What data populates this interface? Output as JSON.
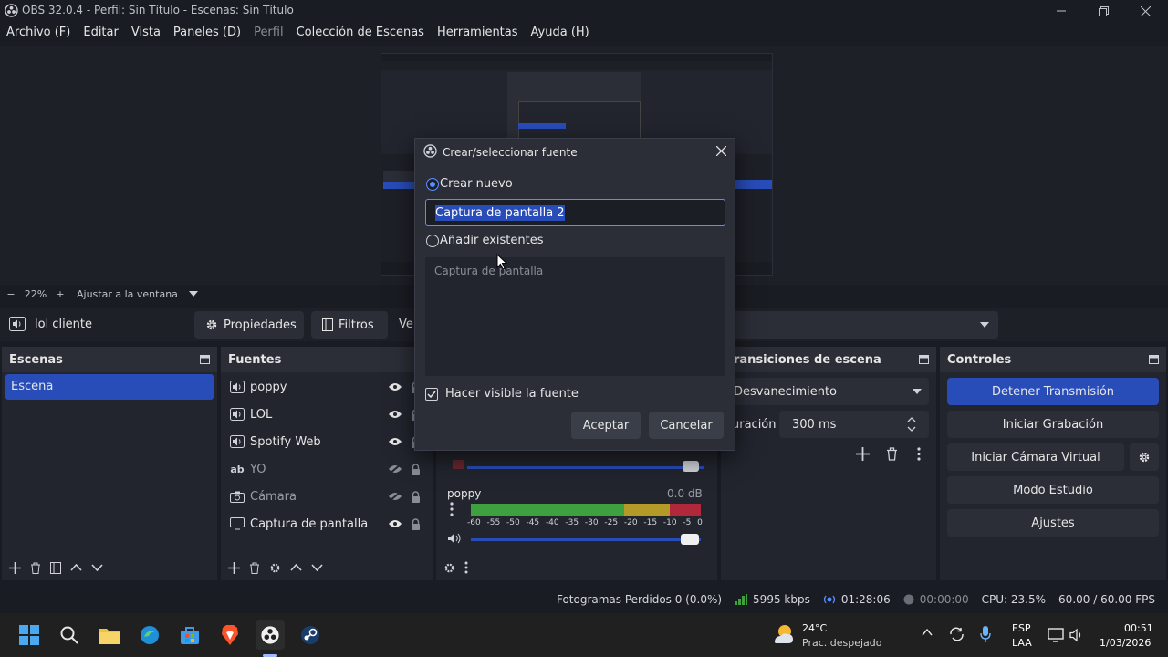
{
  "window": {
    "title": "OBS 32.0.4 - Perfil: Sin Título - Escenas: Sin Título"
  },
  "menu": [
    "Archivo (F)",
    "Editar",
    "Vista",
    "Paneles (D)",
    "Perfil",
    "Colección de Escenas",
    "Herramientas",
    "Ayuda (H)"
  ],
  "zoom": {
    "minus": "−",
    "level": "22%",
    "plus": "+",
    "fit": "Ajustar a la ventana"
  },
  "source_toolbar": {
    "selected_source": "lol cliente",
    "properties": "Propiedades",
    "filters": "Filtros",
    "cut_label": "Ve"
  },
  "scenes": {
    "title": "Escenas",
    "items": [
      "Escena"
    ]
  },
  "sources": {
    "title": "Fuentes",
    "items": [
      {
        "name": "poppy",
        "icon": "speaker-icon",
        "visible": true
      },
      {
        "name": "LOL",
        "icon": "speaker-icon",
        "visible": true
      },
      {
        "name": "Spotify Web",
        "icon": "speaker-icon",
        "visible": true
      },
      {
        "name": "YO",
        "icon": "text-icon",
        "visible": false
      },
      {
        "name": "Cámara",
        "icon": "camera-icon",
        "visible": false
      },
      {
        "name": "Captura de pantalla",
        "icon": "monitor-icon",
        "visible": true
      }
    ]
  },
  "mixer": {
    "channel": "poppy",
    "db": "0.0 dB",
    "scale": [
      "-60",
      "-55",
      "-50",
      "-45",
      "-40",
      "-35",
      "-30",
      "-25",
      "-20",
      "-15",
      "-10",
      "-5",
      "0"
    ]
  },
  "transitions": {
    "title": "Transiciones de escena",
    "title_visible": "ransiciones de escena",
    "type": "Desvanecimiento",
    "duration_label": "uración",
    "duration": "300 ms"
  },
  "controls": {
    "title": "Controles",
    "stop_stream": "Detener Transmisión",
    "start_recording": "Iniciar Grabación",
    "virtual_cam": "Iniciar Cámara Virtual",
    "studio_mode": "Modo Estudio",
    "settings": "Ajustes"
  },
  "status": {
    "dropped": "Fotogramas Perdidos 0 (0.0%)",
    "bitrate": "5995 kbps",
    "stream_time": "01:28:06",
    "rec_time": "00:00:00",
    "cpu": "CPU: 23.5%",
    "fps": "60.00 / 60.00 FPS"
  },
  "dialog": {
    "title": "Crear/seleccionar fuente",
    "create_new": "Crear nuevo",
    "name_value": "Captura de pantalla 2",
    "add_existing": "Añadir existentes",
    "existing_item": "Captura de pantalla",
    "make_visible": "Hacer visible la fuente",
    "accept": "Aceptar",
    "cancel": "Cancelar"
  },
  "taskbar": {
    "temp": "24°C",
    "weather": "Prac. despejado",
    "lang1": "ESP",
    "lang2": "LAA",
    "time": "00:51",
    "date": "1/03/2026"
  },
  "colors": {
    "accent": "#284cb8",
    "panel": "#22252e",
    "header": "#2b2e37"
  }
}
